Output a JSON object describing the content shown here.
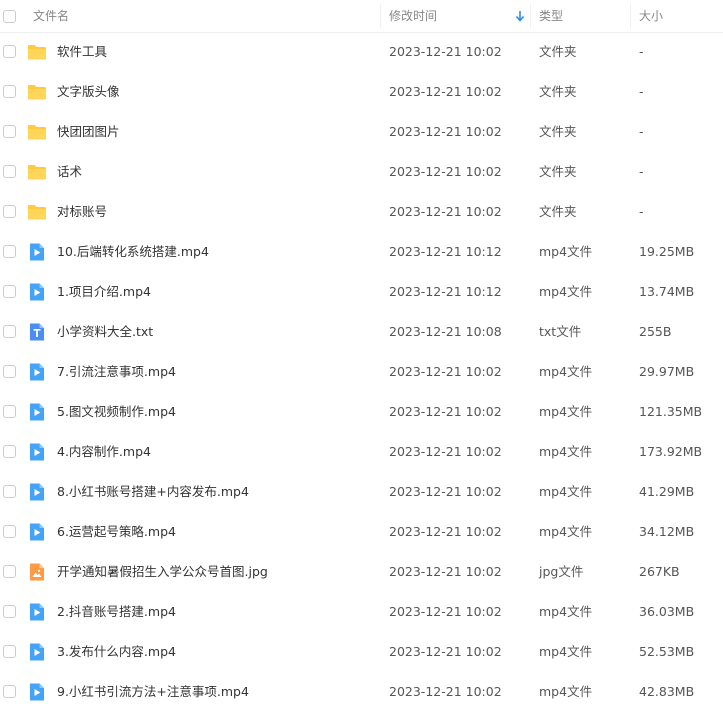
{
  "header": {
    "name": "文件名",
    "modified": "修改时间",
    "type": "类型",
    "size": "大小"
  },
  "files": [
    {
      "icon": "folder-icon",
      "name": "软件工具",
      "modified": "2023-12-21 10:02",
      "type": "文件夹",
      "size": "-"
    },
    {
      "icon": "folder-icon",
      "name": "文字版头像",
      "modified": "2023-12-21 10:02",
      "type": "文件夹",
      "size": "-"
    },
    {
      "icon": "folder-icon",
      "name": "快团团图片",
      "modified": "2023-12-21 10:02",
      "type": "文件夹",
      "size": "-"
    },
    {
      "icon": "folder-icon",
      "name": "话术",
      "modified": "2023-12-21 10:02",
      "type": "文件夹",
      "size": "-"
    },
    {
      "icon": "folder-icon",
      "name": "对标账号",
      "modified": "2023-12-21 10:02",
      "type": "文件夹",
      "size": "-"
    },
    {
      "icon": "video-file-icon",
      "name": "10.后端转化系统搭建.mp4",
      "modified": "2023-12-21 10:12",
      "type": "mp4文件",
      "size": "19.25MB"
    },
    {
      "icon": "video-file-icon",
      "name": "1.项目介绍.mp4",
      "modified": "2023-12-21 10:12",
      "type": "mp4文件",
      "size": "13.74MB"
    },
    {
      "icon": "text-file-icon",
      "name": "小学资料大全.txt",
      "modified": "2023-12-21 10:08",
      "type": "txt文件",
      "size": "255B"
    },
    {
      "icon": "video-file-icon",
      "name": "7.引流注意事项.mp4",
      "modified": "2023-12-21 10:02",
      "type": "mp4文件",
      "size": "29.97MB"
    },
    {
      "icon": "video-file-icon",
      "name": "5.图文视频制作.mp4",
      "modified": "2023-12-21 10:02",
      "type": "mp4文件",
      "size": "121.35MB"
    },
    {
      "icon": "video-file-icon",
      "name": "4.内容制作.mp4",
      "modified": "2023-12-21 10:02",
      "type": "mp4文件",
      "size": "173.92MB"
    },
    {
      "icon": "video-file-icon",
      "name": "8.小红书账号搭建+内容发布.mp4",
      "modified": "2023-12-21 10:02",
      "type": "mp4文件",
      "size": "41.29MB"
    },
    {
      "icon": "video-file-icon",
      "name": "6.运营起号策略.mp4",
      "modified": "2023-12-21 10:02",
      "type": "mp4文件",
      "size": "34.12MB"
    },
    {
      "icon": "image-file-icon",
      "name": "开学通知暑假招生入学公众号首图.jpg",
      "modified": "2023-12-21 10:02",
      "type": "jpg文件",
      "size": "267KB"
    },
    {
      "icon": "video-file-icon",
      "name": "2.抖音账号搭建.mp4",
      "modified": "2023-12-21 10:02",
      "type": "mp4文件",
      "size": "36.03MB"
    },
    {
      "icon": "video-file-icon",
      "name": "3.发布什么内容.mp4",
      "modified": "2023-12-21 10:02",
      "type": "mp4文件",
      "size": "52.53MB"
    },
    {
      "icon": "video-file-icon",
      "name": "9.小红书引流方法+注意事项.mp4",
      "modified": "2023-12-21 10:02",
      "type": "mp4文件",
      "size": "42.83MB"
    }
  ],
  "colors": {
    "folder": "#FFC940",
    "video": "#45A3F5",
    "text": "#4A8DF5",
    "image": "#FF9A45"
  }
}
